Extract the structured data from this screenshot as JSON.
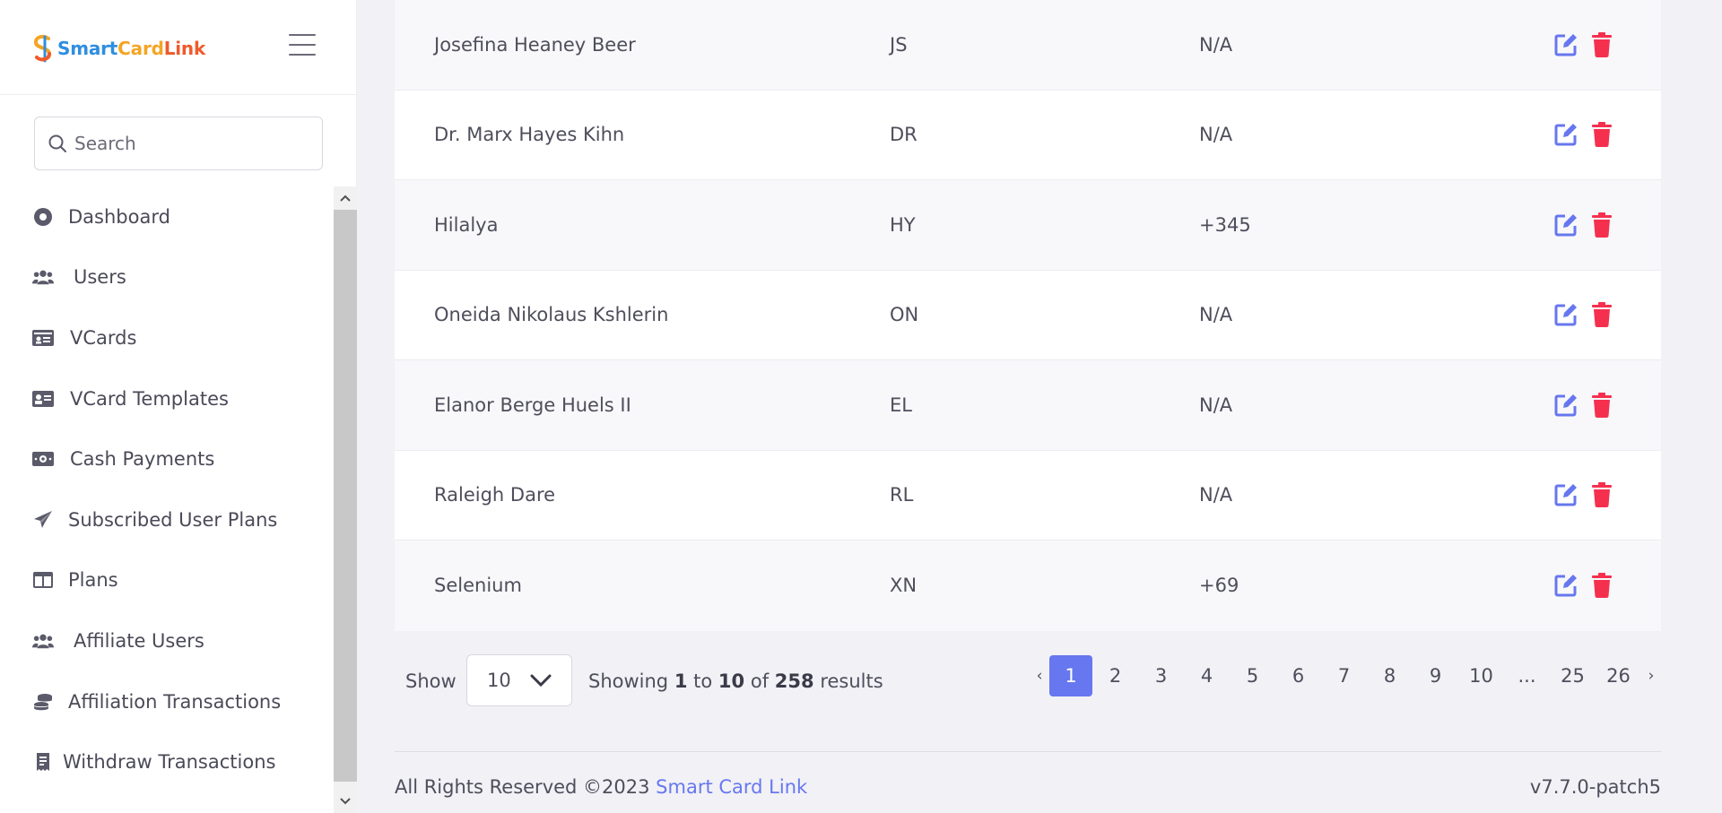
{
  "brand": {
    "part1": "Smart",
    "part2": "Card",
    "part3": "Link"
  },
  "search": {
    "placeholder": "Search"
  },
  "sidebar": {
    "items": [
      {
        "label": "Dashboard",
        "icon": "dashboard-icon"
      },
      {
        "label": "Users",
        "icon": "users-icon"
      },
      {
        "label": "VCards",
        "icon": "vcard-icon"
      },
      {
        "label": "VCard Templates",
        "icon": "id-card-icon"
      },
      {
        "label": "Cash Payments",
        "icon": "money-icon"
      },
      {
        "label": "Subscribed User Plans",
        "icon": "paper-plane-icon"
      },
      {
        "label": "Plans",
        "icon": "columns-icon"
      },
      {
        "label": "Affiliate Users",
        "icon": "users-icon"
      },
      {
        "label": "Affiliation Transactions",
        "icon": "coins-icon"
      },
      {
        "label": "Withdraw Transactions",
        "icon": "receipt-icon"
      }
    ]
  },
  "table": {
    "rows": [
      {
        "name": "Josefina Heaney Beer",
        "code": "JS",
        "phone": "N/A"
      },
      {
        "name": "Dr. Marx Hayes Kihn",
        "code": "DR",
        "phone": "N/A"
      },
      {
        "name": "Hilalya",
        "code": "HY",
        "phone": "+345"
      },
      {
        "name": "Oneida Nikolaus Kshlerin",
        "code": "ON",
        "phone": "N/A"
      },
      {
        "name": "Elanor Berge Huels II",
        "code": "EL",
        "phone": "N/A"
      },
      {
        "name": "Raleigh Dare",
        "code": "RL",
        "phone": "N/A"
      },
      {
        "name": "Selenium",
        "code": "XN",
        "phone": "+69"
      }
    ]
  },
  "pager": {
    "show_label": "Show",
    "page_size": "10",
    "showing_prefix": "Showing",
    "from": "1",
    "to_word": "to",
    "to": "10",
    "of_word": "of",
    "total": "258",
    "results_word": "results",
    "prev": "‹",
    "next": "›",
    "pages": [
      "1",
      "2",
      "3",
      "4",
      "5",
      "6",
      "7",
      "8",
      "9",
      "10",
      "...",
      "25",
      "26"
    ],
    "active_page": "1"
  },
  "footer": {
    "copyright": "All Rights Reserved ©2023",
    "link_text": "Smart Card Link",
    "version": "v7.7.0-patch5"
  },
  "colors": {
    "accent": "#6777ef",
    "danger": "#f5304e",
    "edit": "#6777ef"
  }
}
